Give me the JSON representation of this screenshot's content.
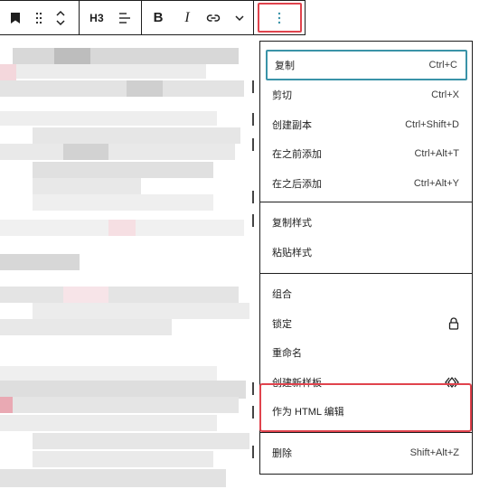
{
  "toolbar": {
    "block_icon": "bookmark-icon",
    "drag_icon": "drag-handle-icon",
    "move_icon": "move-up-down-icon",
    "heading_level": "H3",
    "align_icon": "align-text-icon",
    "bold_label": "B",
    "italic_label": "I",
    "link_icon": "link-icon",
    "more_format_icon": "chevron-down-icon",
    "options_icon": "vertical-ellipsis-icon"
  },
  "menu": {
    "groups": [
      [
        {
          "label": "复制",
          "shortcut": "Ctrl+C",
          "focused": true
        },
        {
          "label": "剪切",
          "shortcut": "Ctrl+X"
        },
        {
          "label": "创建副本",
          "shortcut": "Ctrl+Shift+D"
        },
        {
          "label": "在之前添加",
          "shortcut": "Ctrl+Alt+T"
        },
        {
          "label": "在之后添加",
          "shortcut": "Ctrl+Alt+Y"
        }
      ],
      [
        {
          "label": "复制样式"
        },
        {
          "label": "粘贴样式"
        }
      ],
      [
        {
          "label": "组合"
        },
        {
          "label": "锁定",
          "icon": "lock-icon"
        },
        {
          "label": "重命名"
        },
        {
          "label": "创建新样板",
          "icon": "pattern-icon"
        },
        {
          "label": "作为 HTML 编辑",
          "highlighted": true
        }
      ],
      [
        {
          "label": "删除",
          "shortcut": "Shift+Alt+Z"
        }
      ]
    ]
  },
  "colors": {
    "highlight": "#e0434d",
    "focus": "#3a93a8",
    "border": "#1e1e1e"
  }
}
